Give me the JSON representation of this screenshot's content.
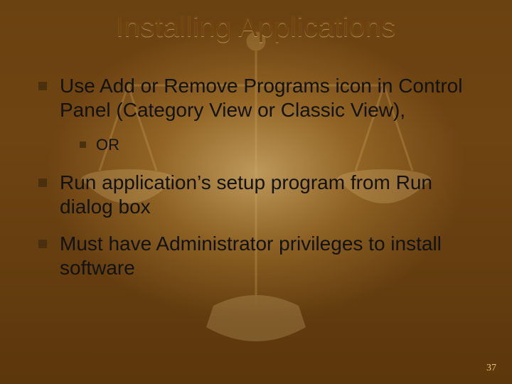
{
  "title": "Installing Applications",
  "bullets": {
    "b1": "Use Add or Remove Programs icon in Control Panel (Category View or Classic View),",
    "b1_sub": "OR",
    "b2": "Run application’s setup program from Run dialog box",
    "b3": "Must have Administrator privileges to install software"
  },
  "page_number": "37"
}
